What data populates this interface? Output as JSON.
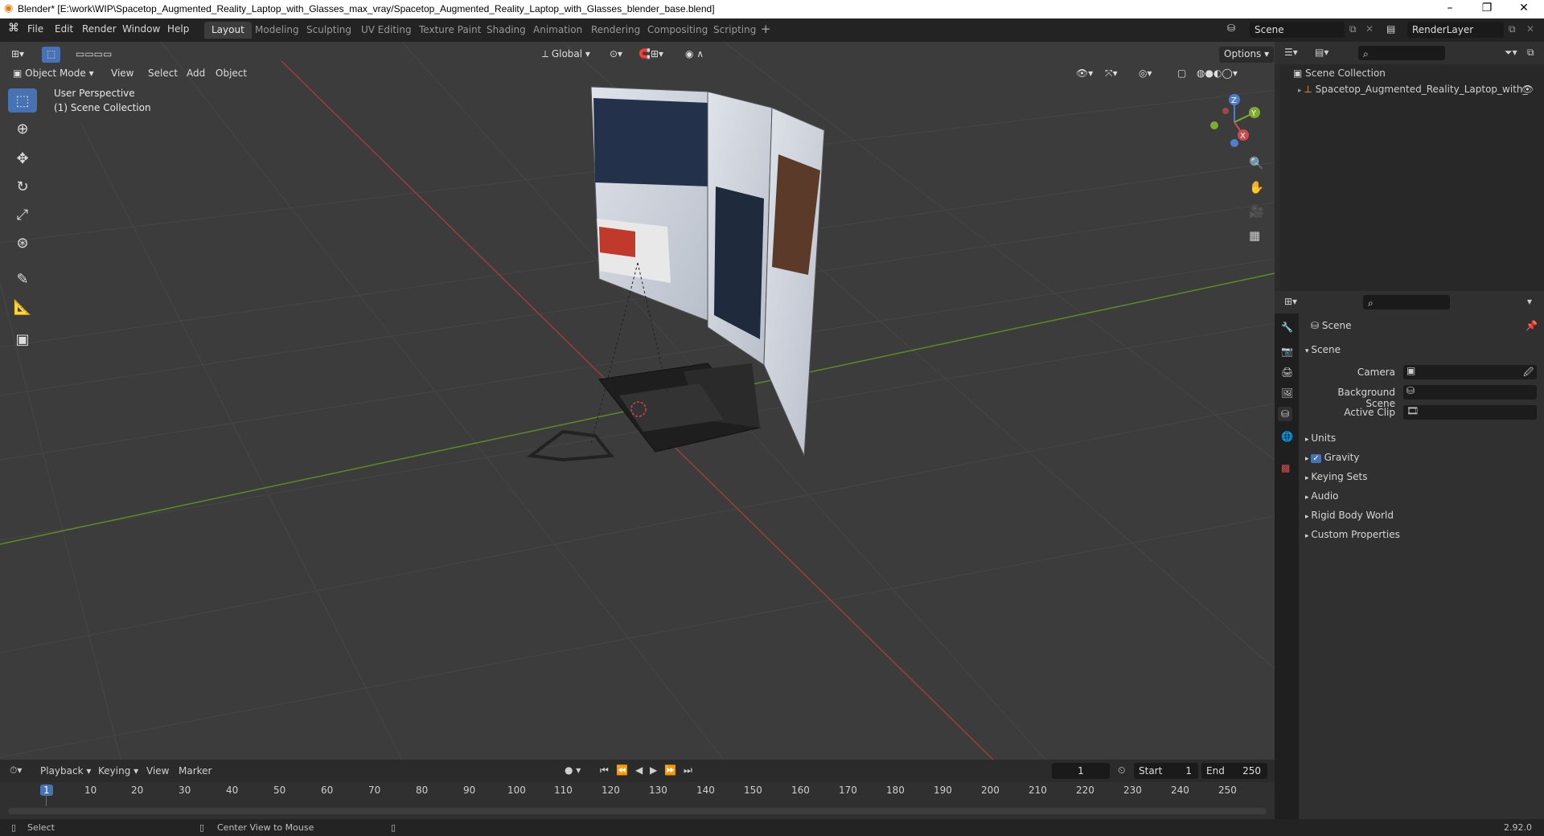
{
  "window": {
    "title": "Blender* [E:\\work\\WIP\\Spacetop_Augmented_Reality_Laptop_with_Glasses_max_vray/Spacetop_Augmented_Reality_Laptop_with_Glasses_blender_base.blend]",
    "controls": [
      "–",
      "❐",
      "✕"
    ]
  },
  "menu": [
    "File",
    "Edit",
    "Render",
    "Window",
    "Help"
  ],
  "workspaces": [
    "Layout",
    "Modeling",
    "Sculpting",
    "UV Editing",
    "Texture Paint",
    "Shading",
    "Animation",
    "Rendering",
    "Compositing",
    "Scripting"
  ],
  "active_workspace": "Layout",
  "scene_field": "Scene",
  "renderlayer_field": "RenderLayer",
  "viewport": {
    "mode": "Object Mode",
    "menus": [
      "View",
      "Select",
      "Add",
      "Object"
    ],
    "orientation": "Global",
    "options": "Options",
    "perspective": "User Perspective",
    "collection": "(1) Scene Collection",
    "gizmo": {
      "z": "Z",
      "y": "Y",
      "x": "X"
    }
  },
  "outliner": {
    "root": "Scene Collection",
    "item": "Spacetop_Augmented_Reality_Laptop_with_"
  },
  "properties": {
    "header": "Scene",
    "panel": "Scene",
    "fields": [
      {
        "label": "Camera"
      },
      {
        "label": "Background Scene"
      },
      {
        "label": "Active Clip"
      }
    ],
    "subpanels": [
      "Units",
      "Gravity",
      "Keying Sets",
      "Audio",
      "Rigid Body World",
      "Custom Properties"
    ],
    "gravity_checked": true
  },
  "timeline": {
    "menus": [
      "Playback",
      "Keying",
      "View",
      "Marker"
    ],
    "current_frame": "1",
    "start_label": "Start",
    "start": "1",
    "end_label": "End",
    "end": "250",
    "ticks": [
      "1",
      "10",
      "20",
      "30",
      "40",
      "50",
      "60",
      "70",
      "80",
      "90",
      "100",
      "110",
      "120",
      "130",
      "140",
      "150",
      "160",
      "170",
      "180",
      "190",
      "200",
      "210",
      "220",
      "230",
      "240",
      "250"
    ]
  },
  "status": {
    "select": "Select",
    "center_view": "Center View to Mouse",
    "version": "2.92.0"
  },
  "colors": {
    "accent": "#4772b3",
    "x_axis": "#c94d4d",
    "y_axis": "#7dad2e",
    "z_axis": "#4d7fcc"
  }
}
